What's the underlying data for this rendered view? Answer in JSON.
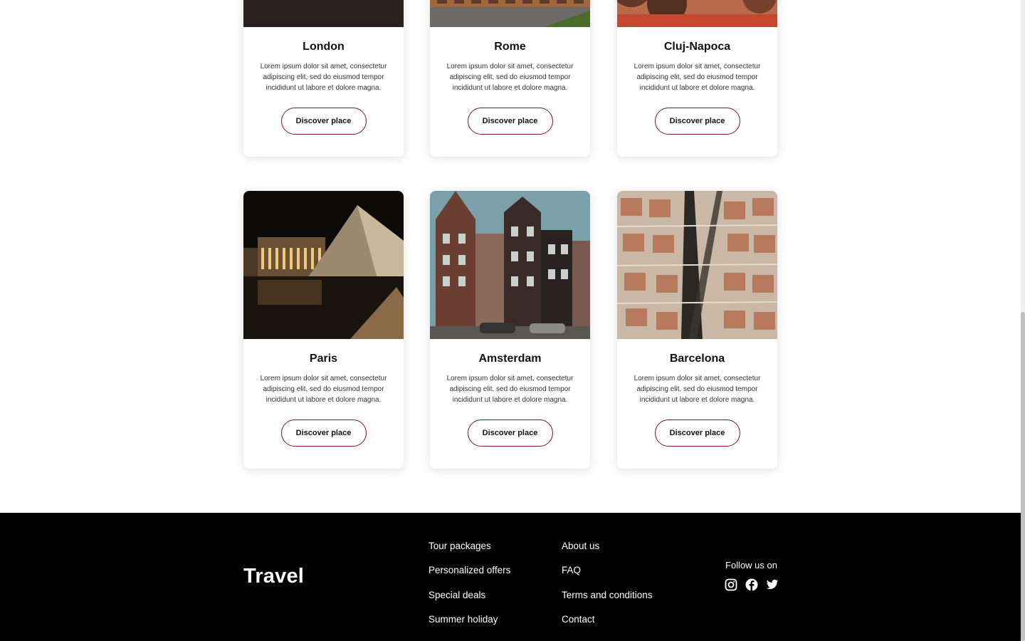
{
  "cards": [
    {
      "title": "London",
      "text": "Lorem ipsum dolor sit amet, consectetur adipiscing elit, sed do eiusmod tempor incididunt ut labore et dolore magna.",
      "button": "Discover place",
      "image": "london-photo"
    },
    {
      "title": "Rome",
      "text": "Lorem ipsum dolor sit amet, consectetur adipiscing elit, sed do eiusmod tempor incididunt ut labore et dolore magna.",
      "button": "Discover place",
      "image": "colosseum-photo"
    },
    {
      "title": "Cluj-Napoca",
      "text": "Lorem ipsum dolor sit amet, consectetur adipiscing elit, sed do eiusmod tempor incididunt ut labore et dolore magna.",
      "button": "Discover place",
      "image": "cluj-rooftops-photo"
    },
    {
      "title": "Paris",
      "text": "Lorem ipsum dolor sit amet, consectetur adipiscing elit, sed do eiusmod tempor incididunt ut labore et dolore magna.",
      "button": "Discover place",
      "image": "louvre-pyramid-photo"
    },
    {
      "title": "Amsterdam",
      "text": "Lorem ipsum dolor sit amet, consectetur adipiscing elit, sed do eiusmod tempor incididunt ut labore et dolore magna.",
      "button": "Discover place",
      "image": "canal-houses-photo"
    },
    {
      "title": "Barcelona",
      "text": "Lorem ipsum dolor sit amet, consectetur adipiscing elit, sed do eiusmod tempor incididunt ut labore et dolore magna.",
      "button": "Discover place",
      "image": "aerial-city-photo"
    }
  ],
  "footer": {
    "brand": "Travel",
    "col1": [
      "Tour packages",
      "Personalized offers",
      "Special deals",
      "Summer holiday"
    ],
    "col2": [
      "About us",
      "FAQ",
      "Terms and conditions",
      "Contact"
    ],
    "follow_label": "Follow us on",
    "socials": [
      "instagram-icon",
      "facebook-icon",
      "twitter-icon"
    ]
  },
  "colors": {
    "accent": "#7a1a24",
    "footer_bg": "#000000"
  }
}
